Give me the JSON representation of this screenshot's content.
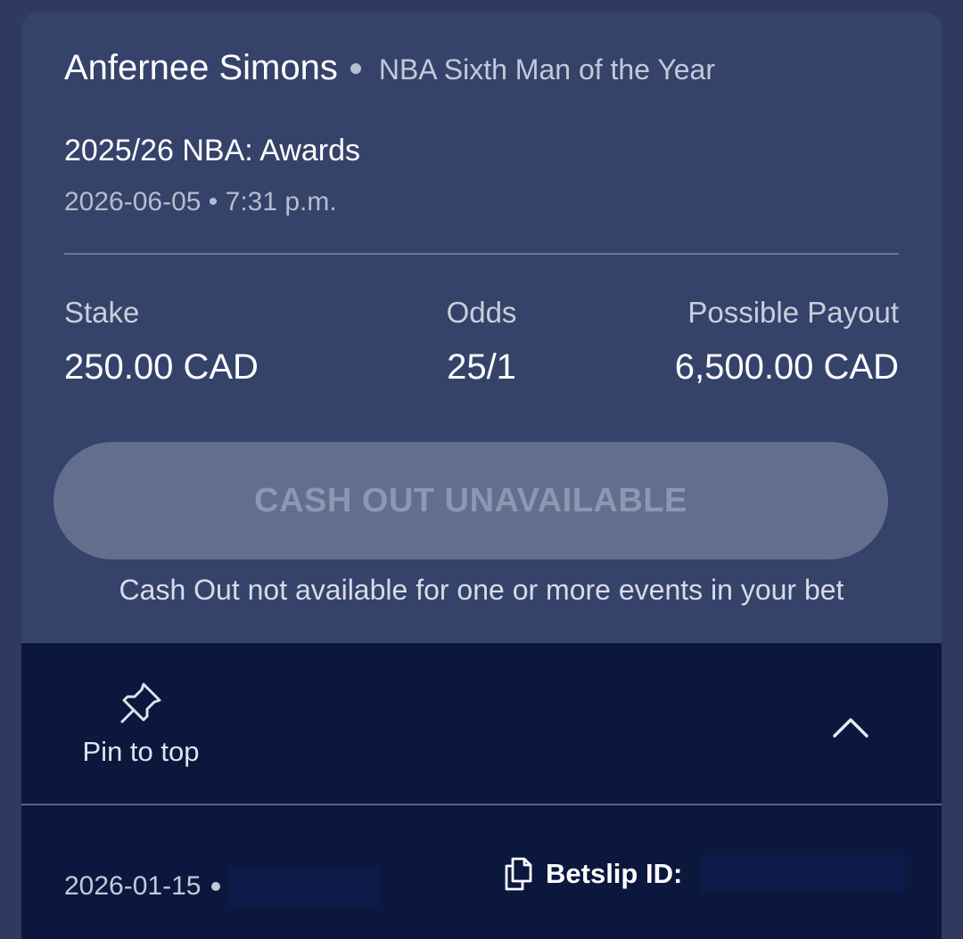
{
  "bet": {
    "selection": "Anfernee Simons",
    "market": "NBA Sixth Man of the Year",
    "event": "2025/26 NBA: Awards",
    "event_datetime": "2026-06-05 • 7:31 p.m.",
    "stake_label": "Stake",
    "stake_value": "250.00 CAD",
    "odds_label": "Odds",
    "odds_value": "25/1",
    "payout_label": "Possible Payout",
    "payout_value": "6,500.00 CAD"
  },
  "cash_out": {
    "button_label": "CASH OUT UNAVAILABLE",
    "note": "Cash Out not available for one or more events in your bet"
  },
  "footer": {
    "pin_label": "Pin to top",
    "pin_icon": "pin-icon",
    "collapse_icon": "chevron-up-icon",
    "placed_date": "2026-01-15",
    "copy_icon": "copy-icon",
    "betslip_label": "Betslip ID:"
  },
  "colors": {
    "background": "#2f3a5e",
    "card": "#35426a",
    "footer": "#0b173c",
    "disabled_button": "#636e8e",
    "disabled_text": "#8d97b4"
  }
}
